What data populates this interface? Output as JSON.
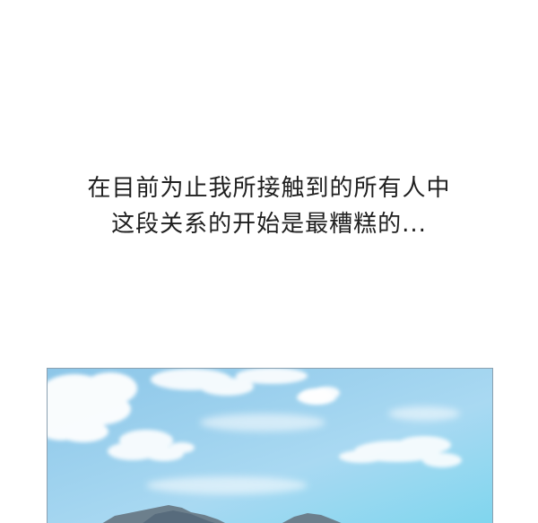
{
  "caption": {
    "line1": "在目前为止我所接触到的所有人中",
    "line2": "这段关系的开始是最糟糕的..."
  },
  "panel": {
    "scene": "sky-with-clouds-and-mountains",
    "colors": {
      "sky_top": "#8ec9ea",
      "sky_bottom": "#bfe3f6",
      "cloud": "#ffffff",
      "mountain": "#5e7280",
      "border": "#8aa0b0"
    }
  }
}
